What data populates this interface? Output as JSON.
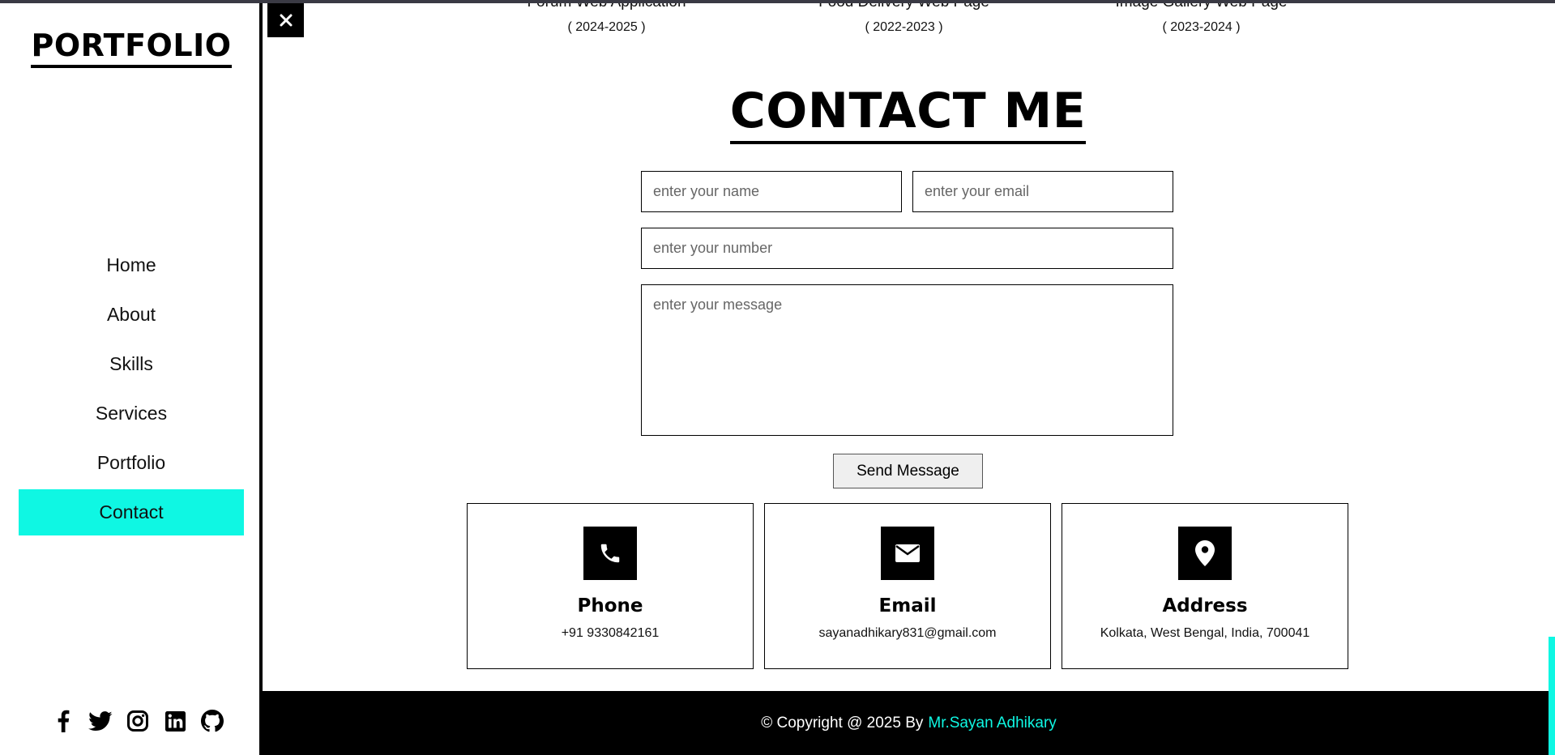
{
  "sidebar": {
    "logo": "PORTFOLIO",
    "nav": [
      {
        "label": "Home"
      },
      {
        "label": "About"
      },
      {
        "label": "Skills"
      },
      {
        "label": "Services"
      },
      {
        "label": "Portfolio"
      },
      {
        "label": "Contact",
        "active": true
      }
    ],
    "socials": [
      "facebook-icon",
      "twitter-icon",
      "instagram-icon",
      "linkedin-icon",
      "github-icon"
    ]
  },
  "close_button": {
    "icon": "close-icon",
    "glyph": "✕"
  },
  "projects": [
    {
      "title": "Forum Web Application",
      "year": "( 2024-2025 )"
    },
    {
      "title": "Food Delivery Web Page",
      "year": "( 2022-2023 )"
    },
    {
      "title": "Image Gallery Web Page",
      "year": "( 2023-2024 )"
    }
  ],
  "contact": {
    "heading": "CONTACT ME",
    "name_placeholder": "enter your name",
    "email_placeholder": "enter your email",
    "number_placeholder": "enter your number",
    "message_placeholder": "enter your message",
    "send_label": "Send Message",
    "cards": [
      {
        "icon": "phone-icon",
        "title": "Phone",
        "value": "+91 9330842161"
      },
      {
        "icon": "envelope-icon",
        "title": "Email",
        "value": "sayanadhikary831@gmail.com"
      },
      {
        "icon": "map-pin-icon",
        "title": "Address",
        "value": "Kolkata, West Bengal, India, 700041"
      }
    ]
  },
  "footer": {
    "copyright": "© Copyright @ 2025 By",
    "author": "Mr.Sayan Adhikary"
  },
  "colors": {
    "accent": "#0ff7e3",
    "dark": "#000000"
  }
}
